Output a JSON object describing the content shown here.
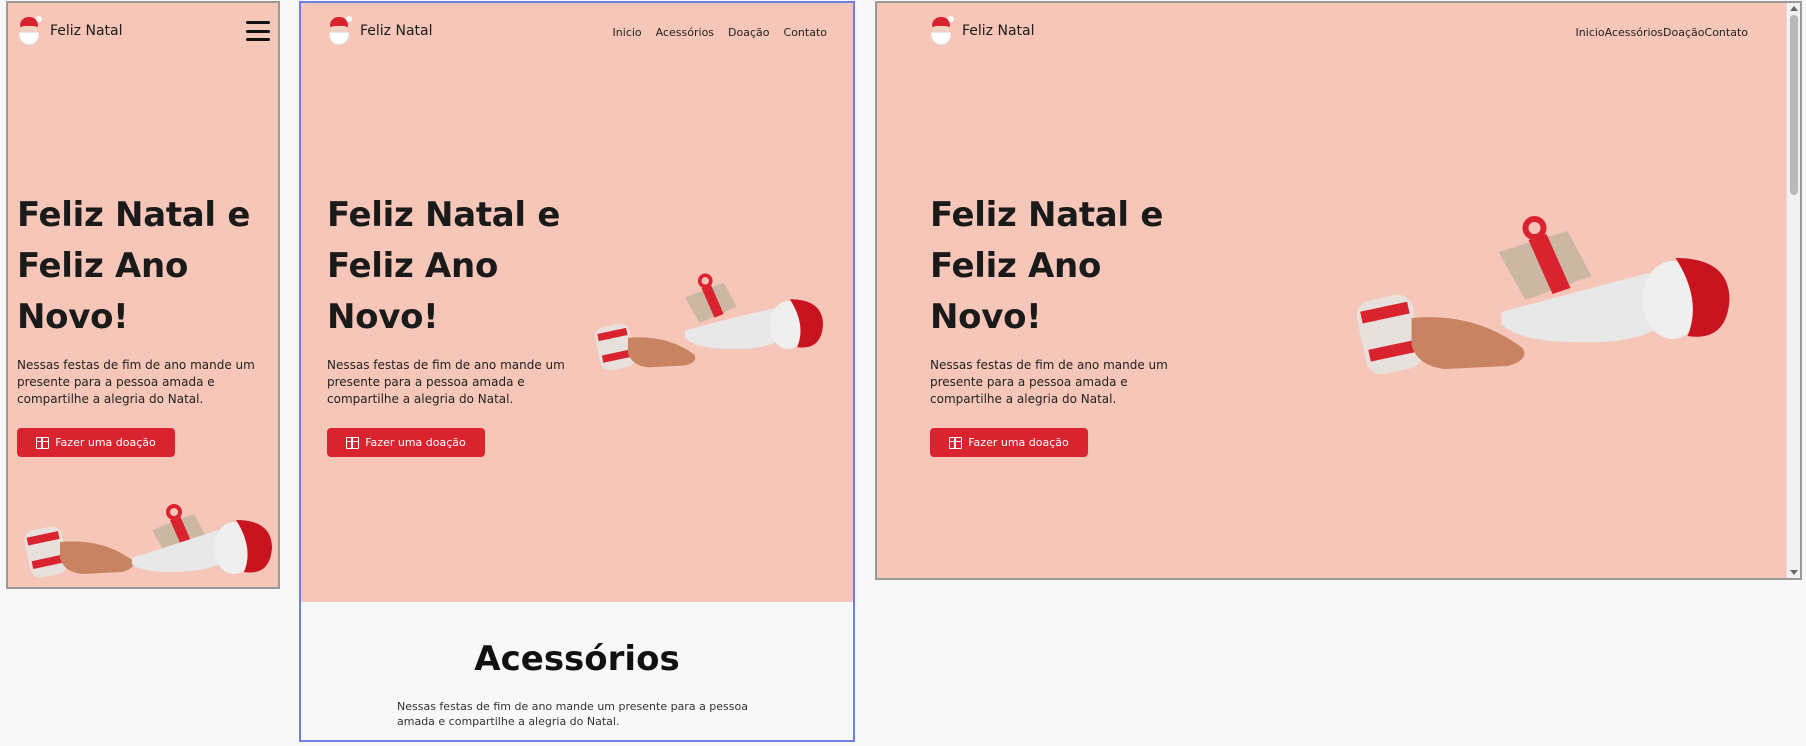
{
  "brand": {
    "name": "Feliz Natal"
  },
  "nav": {
    "items": [
      "Inicio",
      "Acessórios",
      "Doação",
      "Contato"
    ]
  },
  "hero": {
    "title_lines": [
      "Feliz Natal e",
      "Feliz Ano",
      "Novo!"
    ],
    "lead_lines": [
      "Nessas festas de fim de ano mande um",
      "presente para a pessoa amada e",
      "compartilhe a alegria do Natal."
    ],
    "button_label": "Fazer uma doação"
  },
  "accessories": {
    "title": "Acessórios",
    "text_lines": [
      "Nessas festas de fim de ano mande um presente para a pessoa",
      "amada e compartilhe a alegria do Natal."
    ]
  },
  "colors": {
    "hero_bg": "#f6c6b8",
    "accent": "#d9232f",
    "selected_frame_border": "#6f7ee6"
  },
  "icons": [
    "santa-logo-icon",
    "menu-hamburger-icon",
    "gift-icon"
  ]
}
